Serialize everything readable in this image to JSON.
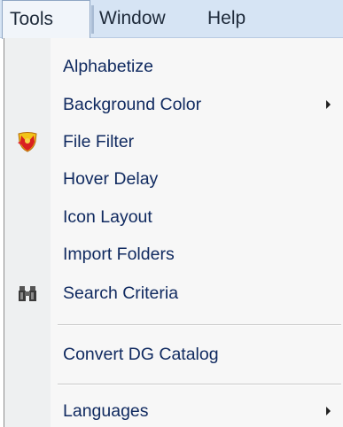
{
  "menubar": {
    "items": [
      "Tools",
      "Window",
      "Help"
    ]
  },
  "menu": {
    "items": [
      {
        "label": "Alphabetize",
        "icon": null,
        "submenu": false
      },
      {
        "label": "Background Color",
        "icon": null,
        "submenu": true
      },
      {
        "label": "File Filter",
        "icon": "shield-icon",
        "submenu": false
      },
      {
        "label": "Hover Delay",
        "icon": null,
        "submenu": false
      },
      {
        "label": "Icon Layout",
        "icon": null,
        "submenu": false
      },
      {
        "label": "Import Folders",
        "icon": null,
        "submenu": false
      },
      {
        "label": "Search Criteria",
        "icon": "binoculars-icon",
        "submenu": false
      },
      {
        "label": "Convert DG Catalog",
        "icon": null,
        "submenu": false
      },
      {
        "label": "Languages",
        "icon": null,
        "submenu": true
      }
    ]
  }
}
